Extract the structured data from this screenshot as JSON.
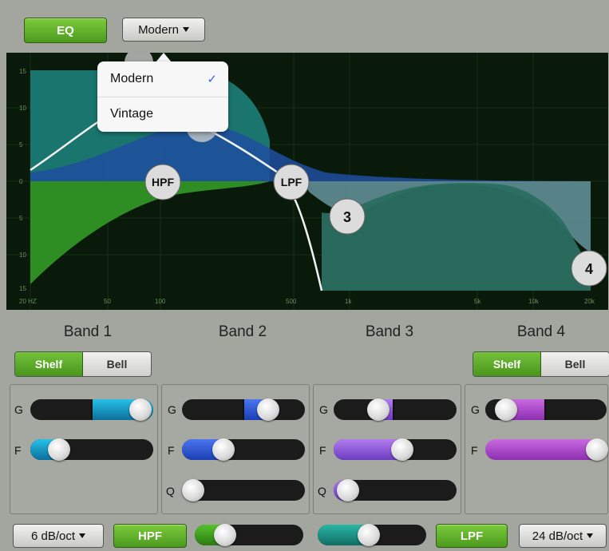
{
  "toolbar": {
    "eq_label": "EQ",
    "mode_label": "Modern"
  },
  "dropdown": {
    "items": [
      "Modern",
      "Vintage"
    ],
    "selected": "Modern",
    "check": "✓"
  },
  "graph": {
    "y_labels": [
      "15",
      "10",
      "5",
      "0",
      "5",
      "10",
      "15"
    ],
    "x_labels": [
      "20 HZ",
      "50",
      "100",
      "500",
      "1k",
      "5k",
      "10k",
      "20k"
    ],
    "nodes": {
      "hpf": "HPF",
      "lpf": "LPF",
      "band3": "3",
      "band4": "4"
    }
  },
  "bands": [
    {
      "title": "Band 1",
      "shelf": "Shelf",
      "bell": "Bell"
    },
    {
      "title": "Band 2"
    },
    {
      "title": "Band 3"
    },
    {
      "title": "Band 4",
      "shelf": "Shelf",
      "bell": "Bell"
    }
  ],
  "labels": {
    "g": "G",
    "f": "F",
    "q": "Q"
  },
  "footer": {
    "hpf_slope": "6 dB/oct",
    "hpf_label": "HPF",
    "lpf_label": "LPF",
    "lpf_slope": "24 dB/oct"
  },
  "colors": {
    "accent_green": "#5fae2a",
    "band1": "#1aa0d0",
    "band2": "#1f4fc4",
    "band3_4": "#9a54d6"
  }
}
